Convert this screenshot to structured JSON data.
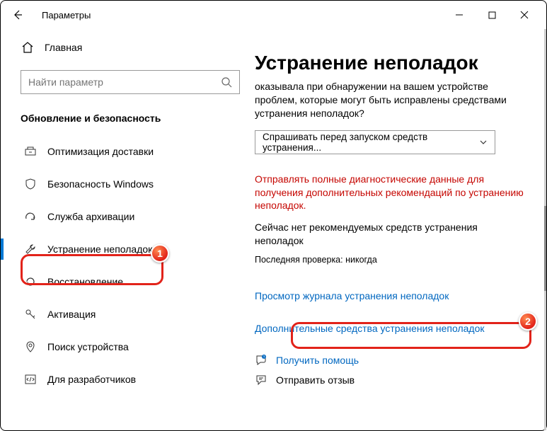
{
  "window": {
    "title": "Параметры"
  },
  "sidebar": {
    "home": "Главная",
    "search_placeholder": "Найти параметр",
    "section": "Обновление и безопасность",
    "items": [
      {
        "label": "Оптимизация доставки"
      },
      {
        "label": "Безопасность Windows"
      },
      {
        "label": "Служба архивации"
      },
      {
        "label": "Устранение неполадок"
      },
      {
        "label": "Восстановление"
      },
      {
        "label": "Активация"
      },
      {
        "label": "Поиск устройства"
      },
      {
        "label": "Для разработчиков"
      }
    ]
  },
  "content": {
    "heading": "Устранение неполадок",
    "desc": "оказывала при обнаружении на вашем устройстве проблем, которые могут быть исправлены средствами устранения неполадок?",
    "select_value": "Спрашивать перед запуском средств устранения...",
    "warn": "Отправлять полные диагностические данные для получения дополнительных рекомендаций по устранению неполадок.",
    "info": "Сейчас нет рекомендуемых средств устранения неполадок",
    "meta": "Последняя проверка: никогда",
    "link_history": "Просмотр журнала устранения неполадок",
    "link_more": "Дополнительные средства устранения неполадок",
    "help": "Получить помощь",
    "feedback": "Отправить отзыв"
  },
  "badges": {
    "b1": "1",
    "b2": "2"
  }
}
